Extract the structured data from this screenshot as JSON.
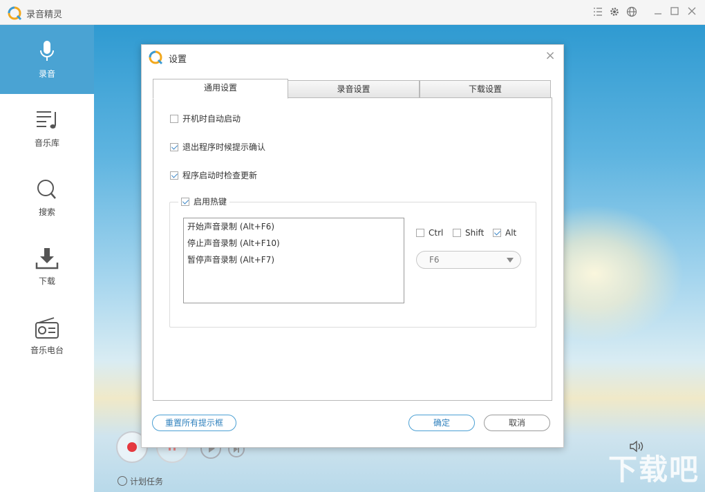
{
  "app": {
    "title": "录音精灵",
    "brand_color": "#4aa3d3",
    "titlebar_icons": [
      "list-icon",
      "gear-icon",
      "globe-icon",
      "minimize-icon",
      "maximize-icon",
      "close-icon"
    ]
  },
  "sidebar": {
    "items": [
      {
        "label": "录音",
        "icon": "microphone-icon",
        "active": true
      },
      {
        "label": "音乐库",
        "icon": "music-list-icon",
        "active": false
      },
      {
        "label": "搜索",
        "icon": "search-icon",
        "active": false
      },
      {
        "label": "下载",
        "icon": "download-icon",
        "active": false
      },
      {
        "label": "音乐电台",
        "icon": "radio-icon",
        "active": false
      }
    ]
  },
  "bottom": {
    "schedule_label": "计划任务",
    "watermark": "下载吧"
  },
  "dialog": {
    "title": "设置",
    "tabs": [
      {
        "label": "通用设置",
        "active": true
      },
      {
        "label": "录音设置",
        "active": false
      },
      {
        "label": "下载设置",
        "active": false
      }
    ],
    "general": {
      "auto_start": {
        "label": "开机时自动启动",
        "checked": false
      },
      "confirm_exit": {
        "label": "退出程序时候提示确认",
        "checked": true
      },
      "check_update": {
        "label": "程序启动时检查更新",
        "checked": true
      },
      "hotkeys": {
        "enable_label": "启用热键",
        "enabled": true,
        "items": [
          "开始声音录制  (Alt+F6)",
          "停止声音录制  (Alt+F10)",
          "暂停声音录制  (Alt+F7)"
        ],
        "modifiers": {
          "ctrl": {
            "label": "Ctrl",
            "checked": false
          },
          "shift": {
            "label": "Shift",
            "checked": false
          },
          "alt": {
            "label": "Alt",
            "checked": true
          }
        },
        "key_value": "F6"
      }
    },
    "buttons": {
      "reset": "重置所有提示框",
      "ok": "确定",
      "cancel": "取消"
    }
  }
}
